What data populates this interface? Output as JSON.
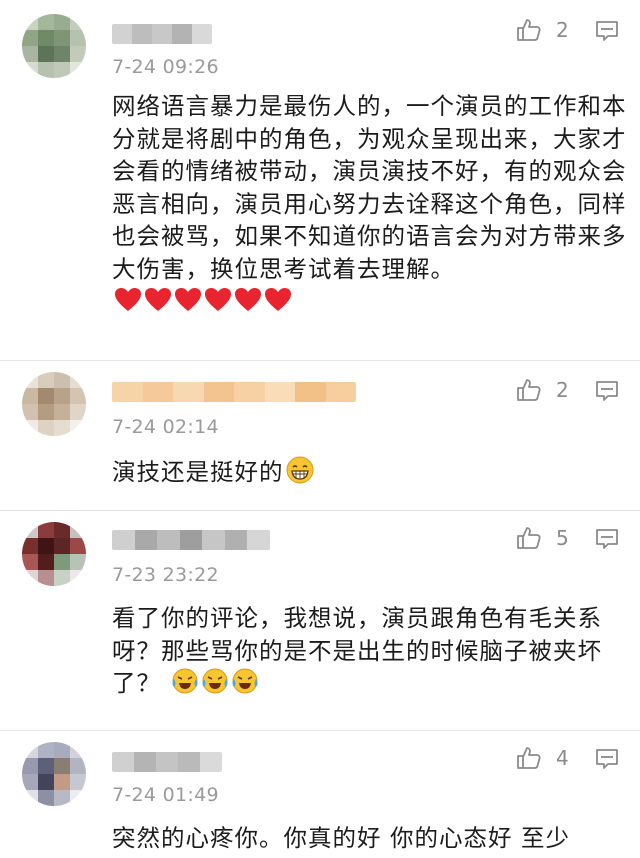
{
  "comments": [
    {
      "time": "7-24 09:26",
      "likes": "2",
      "text": "网络语言暴力是最伤人的，一个演员的工作和本分就是将剧中的角色，为观众呈现出来，大家才会看的情绪被带动，演员演技不好，有的观众会恶言相向，演员用心努力去诠释这个角色，同样也会被骂，如果不知道你的语言会为对方带来多大伤害，换位思考试着去理解。",
      "emoji": [
        "red-heart",
        "red-heart",
        "red-heart",
        "red-heart",
        "red-heart",
        "red-heart"
      ]
    },
    {
      "time": "7-24 02:14",
      "likes": "2",
      "text": "演技还是挺好的",
      "emoji": [
        "grinning-face"
      ]
    },
    {
      "time": "7-23 23:22",
      "likes": "5",
      "text": "看了你的评论，我想说，演员跟角色有毛关系呀？那些骂你的是不是出生的时候脑子被夹坏了？",
      "emoji": [
        "tears-of-joy",
        "tears-of-joy",
        "tears-of-joy"
      ]
    },
    {
      "time": "7-24 01:49",
      "likes": "4",
      "text": "突然的心疼你。你真的好 你的心态好 至少",
      "emoji": []
    }
  ],
  "colors": {
    "timestamp": "#9a9a9a",
    "icon": "#8a8a8a",
    "heart": "#e8242f",
    "emoji_yellow": "#f7c531"
  }
}
